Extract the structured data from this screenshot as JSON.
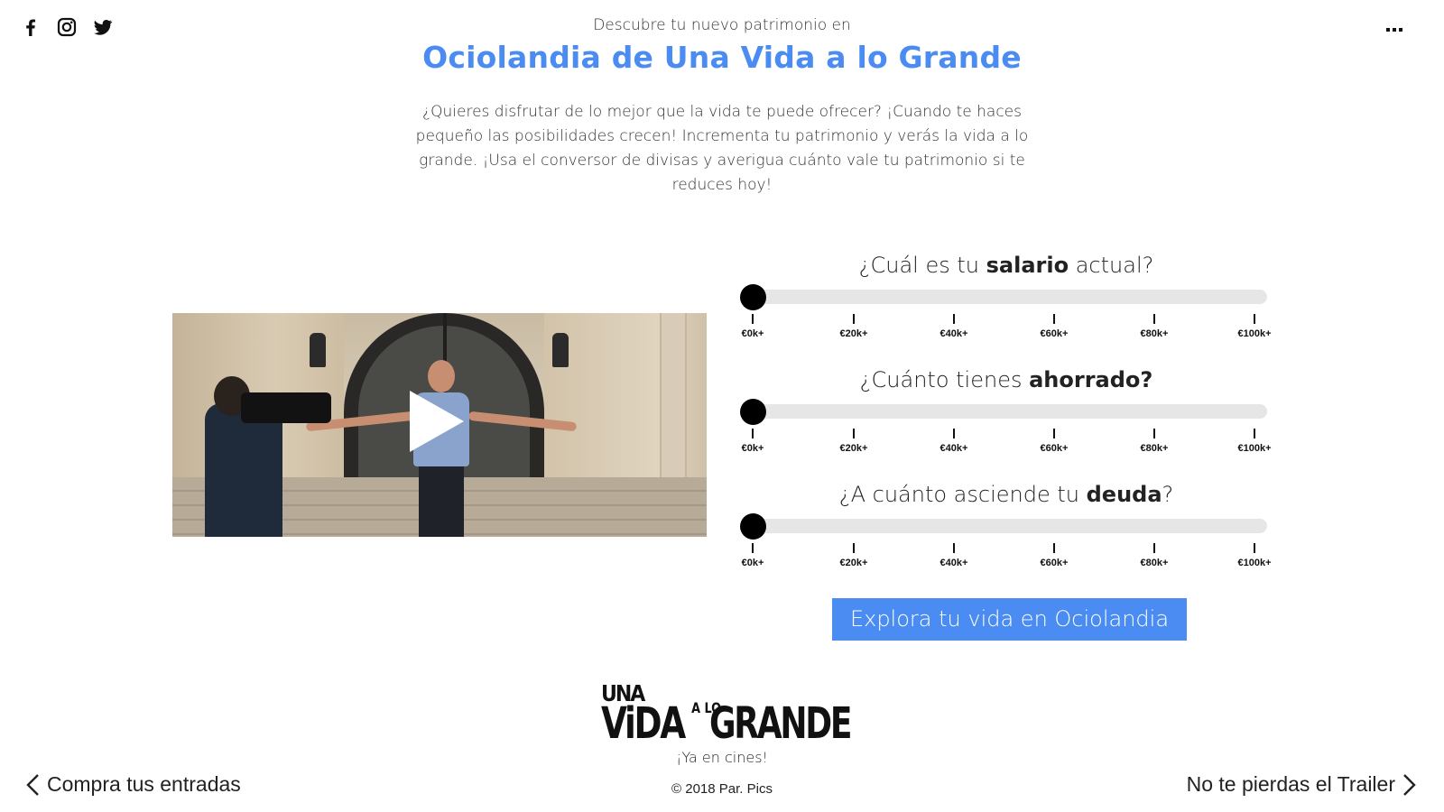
{
  "social": {
    "icons": [
      "facebook-icon",
      "instagram-icon",
      "twitter-icon"
    ]
  },
  "menu": {
    "icon": "more-dots-icon"
  },
  "header": {
    "eyebrow": "Descubre tu nuevo patrimonio en",
    "title": "Ociolandia de Una Vida a lo Grande",
    "intro": "¿Quieres disfrutar de lo mejor que la vida te puede ofrecer? ¡Cuando te haces pequeño las posibilidades crecen! Incrementa tu patrimonio y verás la vida a lo grande. ¡Usa el conversor de divisas y averigua cuánto vale tu patrimonio si te reduces hoy!"
  },
  "video": {
    "play_icon": "play-icon"
  },
  "questions": [
    {
      "pre": "¿Cuál es tu ",
      "bold": "salario",
      "post": " actual?",
      "value": 0
    },
    {
      "pre": "¿Cuánto tienes ",
      "bold": "ahorrado?",
      "post": "",
      "value": 0
    },
    {
      "pre": "¿A cuánto asciende tu ",
      "bold": "deuda",
      "post": "?",
      "value": 0
    }
  ],
  "ticks": [
    "€0k+",
    "€20k+",
    "€40k+",
    "€60k+",
    "€80k+",
    "€100k+"
  ],
  "cta": {
    "label": "Explora tu vida en Ociolandia"
  },
  "logo": {
    "una": "UNA",
    "vida": "ViDA",
    "alo": "A LO",
    "grande": "GRANDE"
  },
  "footer": {
    "tagline": "¡Ya en cines!",
    "copyright": "© 2018 Par. Pics",
    "left_link": "Compra tus entradas",
    "right_link": "No te pierdas el Trailer"
  },
  "colors": {
    "accent": "#4a8cf1",
    "rail": "#e6e6e6",
    "knob": "#000000"
  }
}
